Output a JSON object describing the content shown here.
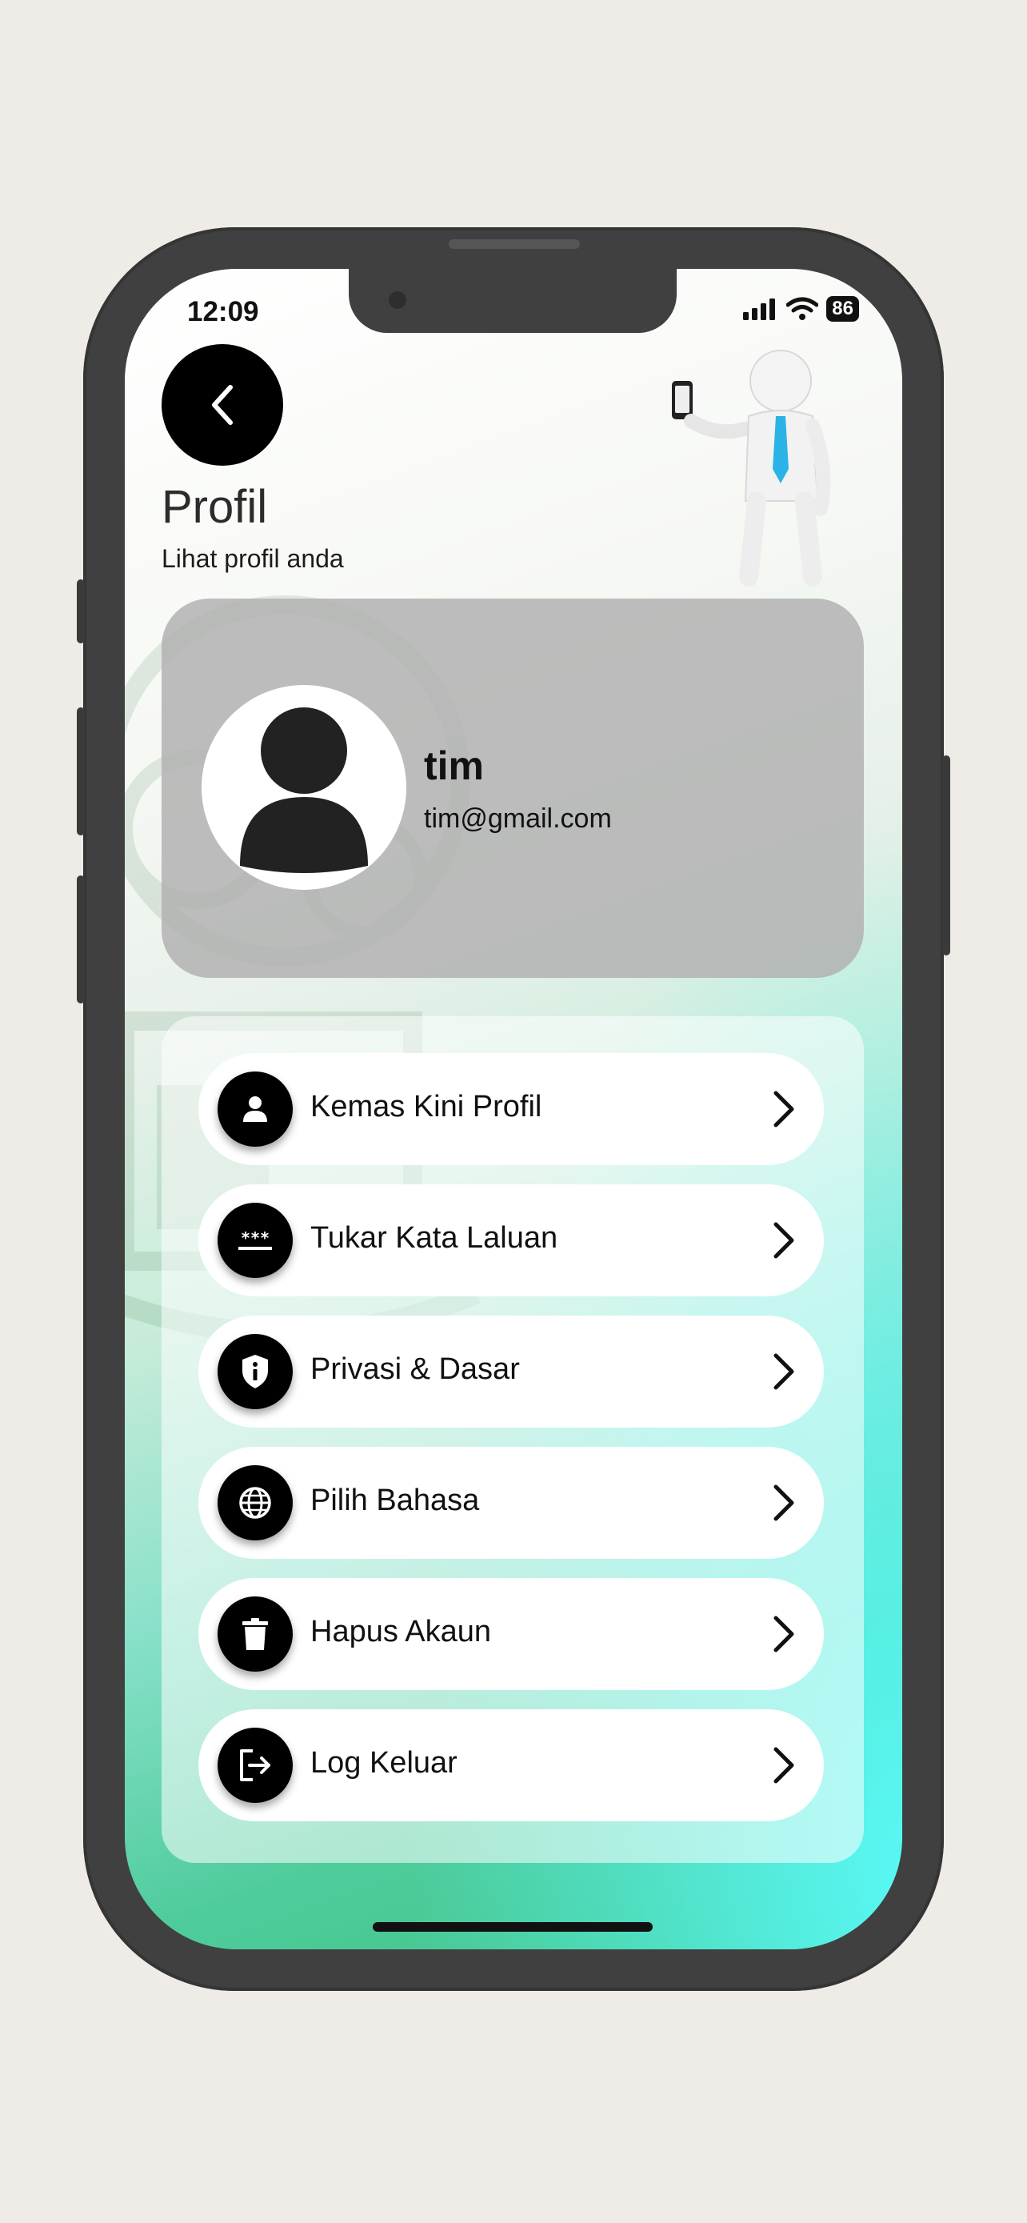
{
  "status": {
    "time": "12:09",
    "battery": "86"
  },
  "header": {
    "title": "Profil",
    "subtitle": "Lihat profil anda"
  },
  "profile": {
    "name": "tim",
    "email": "tim@gmail.com"
  },
  "menu": [
    {
      "label": "Kemas Kini Profil",
      "icon": "person-icon"
    },
    {
      "label": "Tukar Kata Laluan",
      "icon": "password-icon"
    },
    {
      "label": "Privasi & Dasar",
      "icon": "shield-info-icon"
    },
    {
      "label": "Pilih Bahasa",
      "icon": "globe-icon"
    },
    {
      "label": "Hapus Akaun",
      "icon": "trash-icon"
    },
    {
      "label": "Log Keluar",
      "icon": "logout-icon"
    }
  ],
  "colors": {
    "accent_dark": "#000000",
    "card_gray": "#b2b2b2",
    "gradient_green": "#3fc285",
    "gradient_cyan": "#5afafa"
  }
}
